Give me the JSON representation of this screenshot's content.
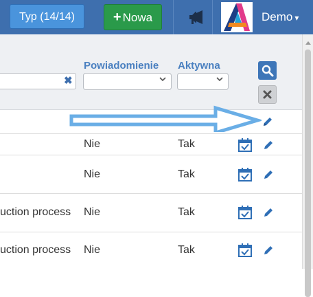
{
  "topbar": {
    "type_button": "Typ (14/14)",
    "new_button_plus": "+",
    "new_button_label": "Nowa",
    "user_label": "Demo",
    "user_caret": "▾",
    "megaphone_icon": "megaphone-icon",
    "logo_icon": "app-logo"
  },
  "filters": {
    "col_notification": "Powiadomienie",
    "col_active": "Aktywna",
    "text_clear": "✖",
    "notification_select_value": "",
    "active_select_value": "",
    "search_icon": "search-icon",
    "clear_icon": "clear-icon"
  },
  "table": {
    "rows": [
      {
        "name": "",
        "notification": "Nie",
        "active": "Tak"
      },
      {
        "name": "",
        "notification": "Nie",
        "active": "Tak"
      },
      {
        "name": "uction process",
        "notification": "Nie",
        "active": "Tak"
      },
      {
        "name": "uction process",
        "notification": "Nie",
        "active": "Tak"
      }
    ]
  },
  "colors": {
    "topbar": "#3e6fae",
    "primary_button": "#4a94dc",
    "success_button": "#2a9a4a",
    "accent_text": "#4a80c0",
    "arrow": "#6aaee6"
  }
}
